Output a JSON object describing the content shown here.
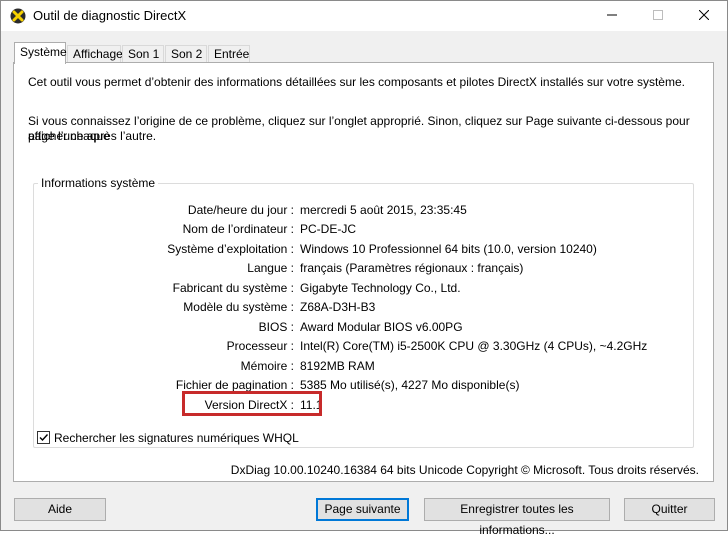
{
  "window": {
    "title": "Outil de diagnostic DirectX",
    "controls": {
      "minimize": "—",
      "maximize": "☐",
      "close": "✕"
    },
    "icon": "directx-icon"
  },
  "tabs": [
    {
      "label": "Système",
      "active": true
    },
    {
      "label": "Affichage",
      "active": false
    },
    {
      "label": "Son 1",
      "active": false
    },
    {
      "label": "Son 2",
      "active": false
    },
    {
      "label": "Entrée",
      "active": false
    }
  ],
  "intro": {
    "line1": "Cet outil vous permet d’obtenir des informations détaillées sur les composants et pilotes DirectX installés sur votre système.",
    "line2a": "Si vous connaissez l’origine de ce problème, cliquez sur l’onglet approprié. Sinon, cliquez sur Page suivante ci-dessous pour afficher chaque",
    "line2b": "page l’une après l’autre."
  },
  "system_info": {
    "legend": "Informations système",
    "rows": [
      {
        "label": "Date/heure du jour :",
        "value": "mercredi 5 août 2015, 23:35:45"
      },
      {
        "label": "Nom de l’ordinateur :",
        "value": "PC-DE-JC"
      },
      {
        "label": "Système d’exploitation :",
        "value": "Windows 10 Professionnel 64 bits (10.0, version 10240)"
      },
      {
        "label": "Langue :",
        "value": "français (Paramètres régionaux : français)"
      },
      {
        "label": "Fabricant du système :",
        "value": "Gigabyte Technology Co., Ltd."
      },
      {
        "label": "Modèle du système :",
        "value": "Z68A-D3H-B3"
      },
      {
        "label": "BIOS :",
        "value": "Award Modular BIOS v6.00PG"
      },
      {
        "label": "Processeur :",
        "value": "Intel(R) Core(TM) i5-2500K CPU @ 3.30GHz (4 CPUs), ~4.2GHz"
      },
      {
        "label": "Mémoire :",
        "value": "8192MB RAM"
      },
      {
        "label": "Fichier de pagination :",
        "value": "5385 Mo utilisé(s), 4227 Mo disponible(s)"
      },
      {
        "label": "Version DirectX :",
        "value": "11.1"
      }
    ],
    "highlight_color": "#c72a2a"
  },
  "whql": {
    "label": "Rechercher les signatures numériques WHQL",
    "checked": true
  },
  "footer_info": "DxDiag 10.00.10240.16384 64 bits Unicode Copyright © Microsoft. Tous droits réservés.",
  "buttons": {
    "help": "Aide",
    "next_page": "Page suivante",
    "save_all": "Enregistrer toutes les informations...",
    "quit": "Quitter"
  }
}
